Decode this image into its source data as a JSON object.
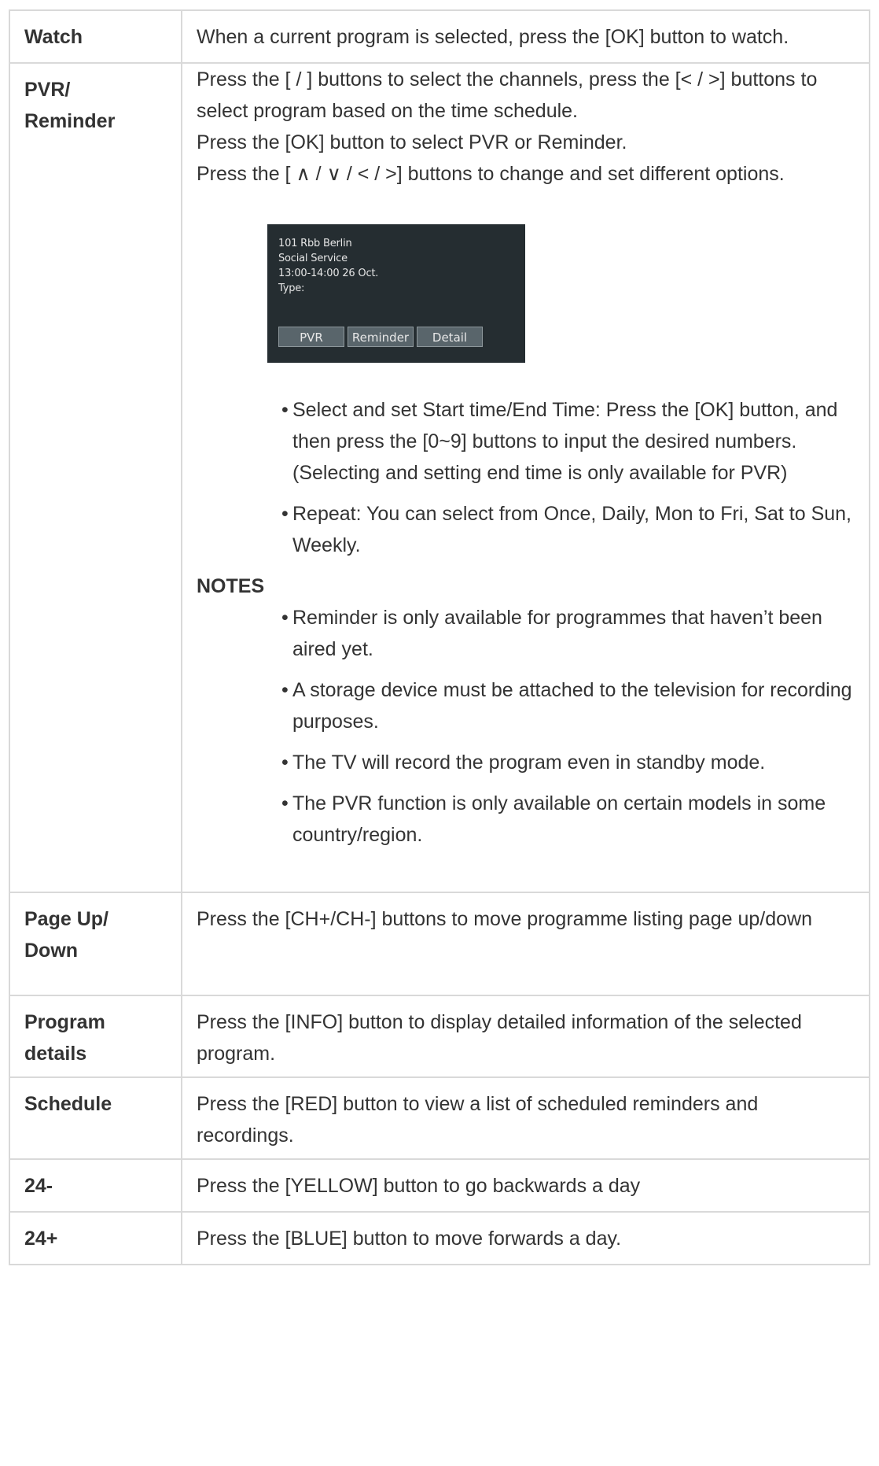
{
  "rows": [
    {
      "key": "Watch",
      "value": "When a current program is selected, press the [OK] button to watch."
    },
    {
      "key_line1": "PVR/",
      "key_line2": "Reminder",
      "paragraphs": [
        "Press the [ / ] buttons to select the channels, press the [< / >] buttons to select program based on the time schedule.",
        "Press the [OK] button to select PVR or Reminder.",
        "Press the [ ∧  / ∨  / < / >] buttons to change and set different options."
      ],
      "tv_screen": {
        "line1": "101  Rbb Berlin",
        "line2": "Social Service",
        "line3": "13:00-14:00    26 Oct.",
        "line4": "Type:",
        "buttons": [
          "PVR",
          "Reminder",
          "Detail"
        ]
      },
      "bullets": [
        "Select and set Start time/End Time: Press the [OK] button, and then press the [0~9] buttons to input the desired numbers. (Selecting and setting end time is only available for PVR)",
        "Repeat: You can select from Once, Daily, Mon to Fri, Sat to Sun, Weekly."
      ],
      "notes_title": "NOTES",
      "notes": [
        "Reminder is only available for programmes that haven’t been aired yet.",
        "A storage device must be attached to the television for recording purposes.",
        "The TV will record the program even in standby mode.",
        "The PVR function is only available on certain models in some country/region."
      ]
    },
    {
      "key_line1": "Page Up/",
      "key_line2": "Down",
      "value": "Press the [CH+/CH-] buttons to move programme listing page up/down"
    },
    {
      "key_line1": "Program",
      "key_line2": "details",
      "value": "Press the [INFO] button to display detailed information of the selected program."
    },
    {
      "key": "Schedule",
      "value": "Press the [RED] button to view a list of scheduled reminders and recordings."
    },
    {
      "key": "24-",
      "value": "Press the [YELLOW] button to go backwards a day"
    },
    {
      "key": "24+",
      "value": "Press the [BLUE] button to move forwards a day."
    }
  ],
  "bullet_char": "•"
}
